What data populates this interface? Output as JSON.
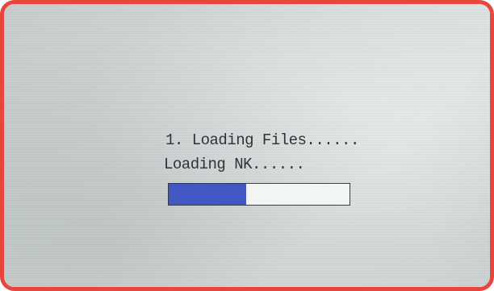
{
  "loader": {
    "step_text": "1. Loading Files......",
    "status_text": "Loading NK......",
    "progress_fraction": 0.43,
    "fill_color": "#4158c4",
    "track_color": "#f3f5f5"
  }
}
